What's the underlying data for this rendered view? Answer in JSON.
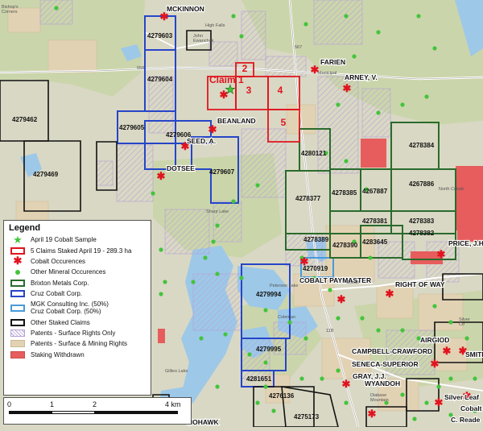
{
  "legend": {
    "title": "Legend",
    "items": [
      {
        "label": "April 19 Cobalt Sample",
        "icon": "green-star-icon"
      },
      {
        "label": "5 Claims Staked April 19 - 289.3 ha",
        "icon": "red-outline-swatch"
      },
      {
        "label": "Cobalt Occurences",
        "icon": "red-asterisk-icon"
      },
      {
        "label": "Other Mineral Occurences",
        "icon": "green-dot-icon"
      },
      {
        "label": "Brixton Metals Corp.",
        "icon": "green-outline-swatch"
      },
      {
        "label": "Cruz Cobalt Corp.",
        "icon": "blue-outline-swatch"
      },
      {
        "label": "MGK Consulting Inc. (50%)\nCruz Cobalt Corp. (50%)",
        "icon": "lightblue-outline-swatch"
      },
      {
        "label": "Other Staked Claims",
        "icon": "black-outline-swatch"
      },
      {
        "label": "Patents - Surface Rights Only",
        "icon": "purple-hatch-swatch"
      },
      {
        "label": "Patents - Surface & Mining Rights",
        "icon": "tan-fill-swatch"
      },
      {
        "label": "Staking Withdrawn",
        "icon": "red-fill-swatch"
      }
    ]
  },
  "scale": {
    "ticks": [
      "0",
      "1",
      "2",
      "4 km"
    ]
  },
  "claims": [
    {
      "id": "4279603",
      "owner": "cruz"
    },
    {
      "id": "4279604",
      "owner": "cruz"
    },
    {
      "id": "4279605",
      "owner": "cruz"
    },
    {
      "id": "4279606",
      "owner": "cruz"
    },
    {
      "id": "4279607",
      "owner": "cruz"
    },
    {
      "id": "4279462",
      "owner": "other"
    },
    {
      "id": "4279469",
      "owner": "other"
    },
    {
      "id": "4280121",
      "owner": "brixton"
    },
    {
      "id": "4278384",
      "owner": "brixton"
    },
    {
      "id": "4278377",
      "owner": "brixton"
    },
    {
      "id": "4278385",
      "owner": "brixton"
    },
    {
      "id": "4267887",
      "owner": "brixton"
    },
    {
      "id": "4267886",
      "owner": "brixton"
    },
    {
      "id": "4278381",
      "owner": "brixton"
    },
    {
      "id": "4278383",
      "owner": "brixton"
    },
    {
      "id": "4278389",
      "owner": "brixton"
    },
    {
      "id": "4278390",
      "owner": "brixton"
    },
    {
      "id": "4283645",
      "owner": "brixton"
    },
    {
      "id": "4278382",
      "owner": "brixton"
    },
    {
      "id": "4270919",
      "owner": "mgk-cruz"
    },
    {
      "id": "4279994",
      "owner": "cruz"
    },
    {
      "id": "4279995",
      "owner": "cruz"
    },
    {
      "id": "4281651",
      "owner": "cruz"
    },
    {
      "id": "4276136",
      "owner": "other"
    },
    {
      "id": "4275173",
      "owner": "other"
    }
  ],
  "new_claims": [
    "2",
    "3",
    "4",
    "5"
  ],
  "new_claim_label": "Claim 1",
  "occurrences": [
    "MCKINNON",
    "FARIEN",
    "ARNEY, V.",
    "BEANLAND",
    "SEED, A.",
    "DOTSEE",
    "PRICE, J.H.",
    "COBALT PAYMASTER",
    "RIGHT OF WAY",
    "AIRGIOD",
    "SMITH",
    "CAMPBELL-CRAWFORD",
    "SENECA-SUPERIOR",
    "GRAY, J.J.",
    "WYANDOH",
    "Silver Leaf",
    "Cobalt",
    "C. Reade",
    "MOHAWK"
  ],
  "map_text": {
    "owner_label": "John\nEwanchuk",
    "place_corners": "Bishop's\nCorners",
    "place_high_falls": "High Falls",
    "place_municipal": "Municipal",
    "place_north_cobalt": "North Cobalt",
    "place_cobalt": "Cobalt",
    "place_sharp_lake": "Sharp Lake",
    "place_coleman": "Coleman",
    "place_peterson_lake": "Peterson Lake",
    "place_gillies_lake": "Gillies Lake",
    "place_diabase": "Diabase\nMountain",
    "place_silver_ctr": "Silver\nCtr",
    "road_558": "558",
    "road_567": "567",
    "road_11b": "11B"
  },
  "colors": {
    "terrain": "#d9d8c4",
    "forest": "#c9d5a8",
    "water": "#9dc8e8",
    "tan": "#e2d2b4",
    "patent_hatch": "#b6a0d6",
    "withdrawn": "#e75d5d",
    "brixton": "#2a6b2d",
    "cruz": "#2645c8",
    "mgk": "#4a9ad8",
    "other": "#111111",
    "new_claims": "#e0141e",
    "occurrence_green": "#43c43c",
    "occurrence_red": "#e0141e"
  }
}
